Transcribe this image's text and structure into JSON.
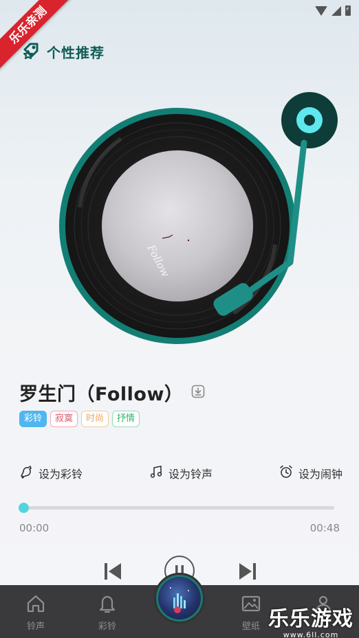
{
  "ribbon": {
    "text": "乐乐亲测"
  },
  "header": {
    "title": "个性推荐",
    "icon": "rocket-badge-icon"
  },
  "song": {
    "title": "罗生门（Follow）",
    "cover_text": "Follow",
    "tags": [
      "彩铃",
      "寂寞",
      "时尚",
      "抒情"
    ]
  },
  "actions": [
    {
      "label": "设为彩铃",
      "icon": "bell-music-icon"
    },
    {
      "label": "设为铃声",
      "icon": "music-note-icon"
    },
    {
      "label": "设为闹钟",
      "icon": "alarm-clock-icon"
    }
  ],
  "player": {
    "current_time": "00:00",
    "total_time": "00:48",
    "progress": 0.0
  },
  "tabs": [
    {
      "label": "铃声",
      "icon": "home-icon"
    },
    {
      "label": "彩铃",
      "icon": "bell-icon"
    },
    {
      "label": "壁纸",
      "icon": "image-icon"
    },
    {
      "label": "",
      "icon": "user-icon"
    }
  ],
  "watermark": {
    "main": "乐乐游戏",
    "sub": "www.6ll.com"
  },
  "colors": {
    "accent": "#0f7d73",
    "accent_light": "#52d4dc",
    "tab_bar": "#3a3a3c",
    "ribbon": "#d9232d"
  }
}
